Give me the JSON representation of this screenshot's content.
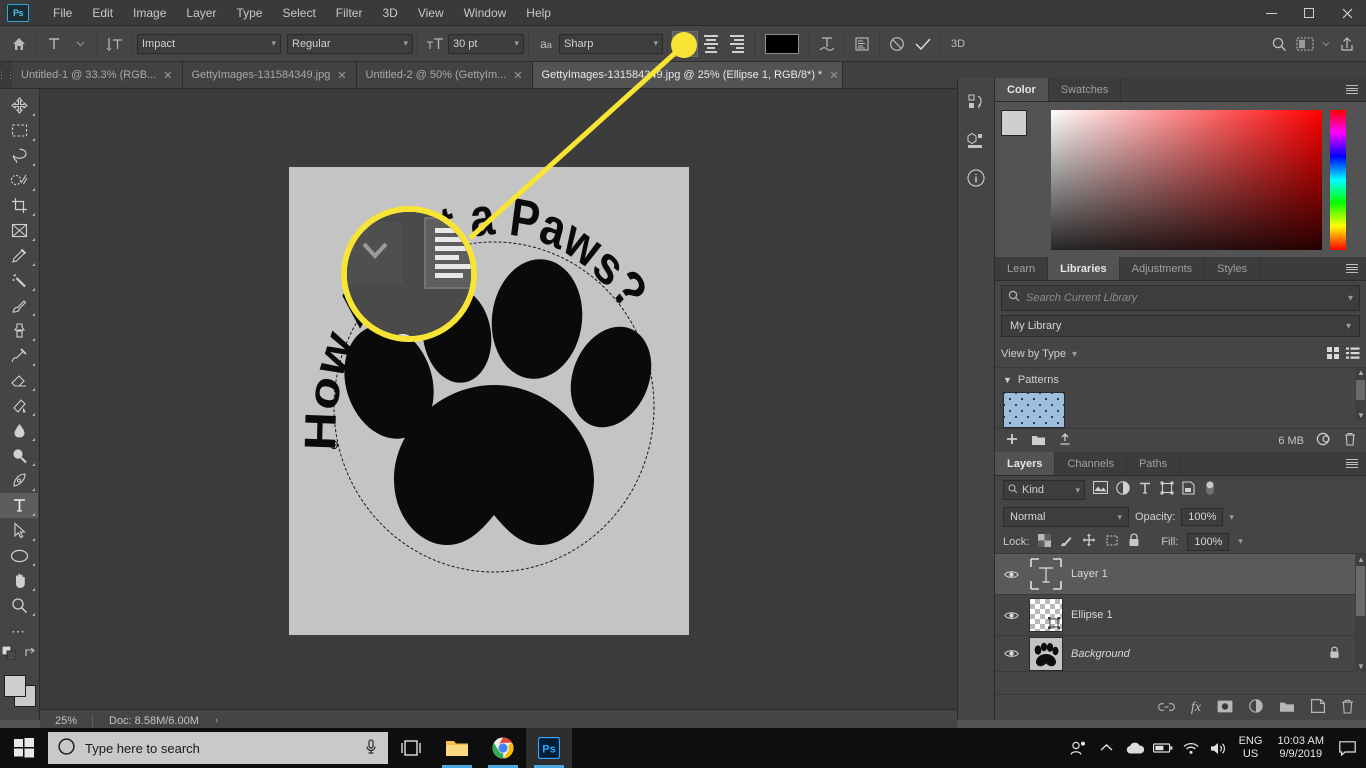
{
  "app": {
    "logo": "Ps"
  },
  "menubar": {
    "items": [
      "File",
      "Edit",
      "Image",
      "Layer",
      "Type",
      "Select",
      "Filter",
      "3D",
      "View",
      "Window",
      "Help"
    ]
  },
  "window_controls": {
    "minimize": "minimize-icon",
    "maximize": "restore-icon",
    "close": "close-icon"
  },
  "options_bar": {
    "home_icon": "home-icon",
    "tool_icon": "type-tool-icon",
    "orientation_icon": "toggle-text-orientation-icon",
    "font_family": "Impact",
    "font_style": "Regular",
    "font_size": "30 pt",
    "antialias_icon": "anti-aliasing-icon",
    "antialias_method": "Sharp",
    "align_left_label": "Left align text",
    "align_center_label": "Center text",
    "align_right_label": "Right align text",
    "color_label": "Text color",
    "color_hex": "#000000",
    "warp_label": "Create warped text",
    "panels_label": "Toggle Character and Paragraph panels",
    "cancel_label": "Cancel any current edits",
    "commit_label": "Commit any current edits",
    "threed_label": "3D",
    "search_label": "Search",
    "workspace_label": "Arrange documents",
    "share_label": "Share an image"
  },
  "tabs": [
    {
      "label": "Untitled-1 @ 33.3% (RGB...",
      "active": false
    },
    {
      "label": "GettyImages-131584349.jpg",
      "active": false
    },
    {
      "label": "Untitled-2 @ 50% (GettyIm...",
      "active": false
    },
    {
      "label": "GettyImages-131584349.jpg @ 25% (Ellipse 1, RGB/8*) *",
      "active": true
    }
  ],
  "toolbar": {
    "tools": [
      {
        "name": "move-tool",
        "label": "Move Tool"
      },
      {
        "name": "rectangular-marquee-tool",
        "label": "Rectangular Marquee Tool"
      },
      {
        "name": "lasso-tool",
        "label": "Lasso Tool"
      },
      {
        "name": "quick-selection-tool",
        "label": "Object Selection Tool"
      },
      {
        "name": "crop-tool",
        "label": "Crop Tool"
      },
      {
        "name": "frame-tool",
        "label": "Frame Tool"
      },
      {
        "name": "eyedropper-tool",
        "label": "Eyedropper Tool"
      },
      {
        "name": "spot-healing-brush-tool",
        "label": "Spot Healing Brush Tool"
      },
      {
        "name": "brush-tool",
        "label": "Brush Tool"
      },
      {
        "name": "clone-stamp-tool",
        "label": "Clone Stamp Tool"
      },
      {
        "name": "history-brush-tool",
        "label": "History Brush Tool"
      },
      {
        "name": "eraser-tool",
        "label": "Eraser Tool"
      },
      {
        "name": "gradient-tool",
        "label": "Gradient Tool"
      },
      {
        "name": "blur-tool",
        "label": "Blur Tool"
      },
      {
        "name": "dodge-tool",
        "label": "Dodge Tool"
      },
      {
        "name": "pen-tool",
        "label": "Pen Tool"
      },
      {
        "name": "horizontal-type-tool",
        "label": "Horizontal Type Tool"
      },
      {
        "name": "path-selection-tool",
        "label": "Path Selection Tool"
      },
      {
        "name": "ellipse-tool",
        "label": "Ellipse Tool"
      },
      {
        "name": "hand-tool",
        "label": "Hand Tool"
      },
      {
        "name": "zoom-tool",
        "label": "Zoom Tool"
      },
      {
        "name": "edit-toolbar",
        "label": "Edit Toolbar"
      }
    ]
  },
  "canvas": {
    "artwork_text": "How About a Paws?",
    "overlay_filename": "1584349.jpg",
    "background_color": "#c4c4c4"
  },
  "status_bar": {
    "zoom": "25%",
    "doc": "Doc: 8.58M/6.00M",
    "arrow": "›"
  },
  "rail": {
    "items": [
      {
        "name": "history-panel-icon",
        "label": "History"
      },
      {
        "name": "properties-panel-icon",
        "label": "Properties"
      },
      {
        "name": "info-panel-icon",
        "label": "Info"
      }
    ]
  },
  "color_panel": {
    "tabs": [
      {
        "label": "Color",
        "active": true
      },
      {
        "label": "Swatches",
        "active": false
      }
    ],
    "foreground_hex": "#cfcfcf",
    "background_hex": "#cfcfcf"
  },
  "libraries_panel": {
    "tabs": [
      {
        "label": "Learn",
        "active": false
      },
      {
        "label": "Libraries",
        "active": true
      },
      {
        "label": "Adjustments",
        "active": false
      },
      {
        "label": "Styles",
        "active": false
      }
    ],
    "search_placeholder": "Search Current Library",
    "selected_library": "My Library",
    "view_label": "View by Type",
    "group_title": "Patterns",
    "size_label": "6 MB",
    "add_label": "Add content",
    "new_group_label": "Create new group",
    "upload_label": "Upload",
    "sync_label": "Creative Cloud sync",
    "delete_label": "Delete"
  },
  "layers_panel": {
    "tabs": [
      {
        "label": "Layers",
        "active": true
      },
      {
        "label": "Channels",
        "active": false
      },
      {
        "label": "Paths",
        "active": false
      }
    ],
    "filter_kind": "Kind",
    "filter_icons": [
      "pixel-filter-icon",
      "adjustment-filter-icon",
      "type-filter-icon",
      "shape-filter-icon",
      "smart-object-filter-icon"
    ],
    "blend_mode": "Normal",
    "opacity_label": "Opacity:",
    "opacity_value": "100%",
    "lock_label": "Lock:",
    "fill_label": "Fill:",
    "fill_value": "100%",
    "layers": [
      {
        "name": "Layer 1",
        "type": "type",
        "selected": true,
        "visible": true,
        "locked": false
      },
      {
        "name": "Ellipse 1",
        "type": "shape",
        "selected": false,
        "visible": true,
        "locked": false
      },
      {
        "name": "Background",
        "type": "image",
        "selected": false,
        "visible": true,
        "locked": true
      }
    ],
    "footer_icons": [
      "link-layers-icon",
      "layer-style-fx-icon",
      "layer-mask-icon",
      "adjustment-layer-icon",
      "new-group-icon",
      "new-layer-icon",
      "delete-layer-icon"
    ]
  },
  "taskbar": {
    "search_placeholder": "Type here to search",
    "cortana_icon": "cortana-circle-icon",
    "mic_icon": "microphone-icon",
    "task_view_icon": "task-view-icon",
    "apps": [
      {
        "name": "file-explorer-icon",
        "label": "File Explorer",
        "running": true
      },
      {
        "name": "chrome-icon",
        "label": "Google Chrome",
        "running": true
      },
      {
        "name": "photoshop-taskbar-icon",
        "label": "Adobe Photoshop",
        "running": true,
        "active": true
      }
    ],
    "tray": {
      "people_icon": "people-icon",
      "chevron_icon": "show-hidden-icons-icon",
      "onedrive_icon": "onedrive-cloud-icon",
      "battery_icon": "battery-icon",
      "wifi_icon": "wifi-icon",
      "volume_icon": "speaker-icon",
      "language_line1": "ENG",
      "language_line2": "US",
      "time": "10:03 AM",
      "date": "9/9/2019",
      "action_center_icon": "action-center-icon"
    }
  },
  "callout": {
    "accent_color": "#f7e434",
    "target_label": "text-alignment-buttons"
  }
}
